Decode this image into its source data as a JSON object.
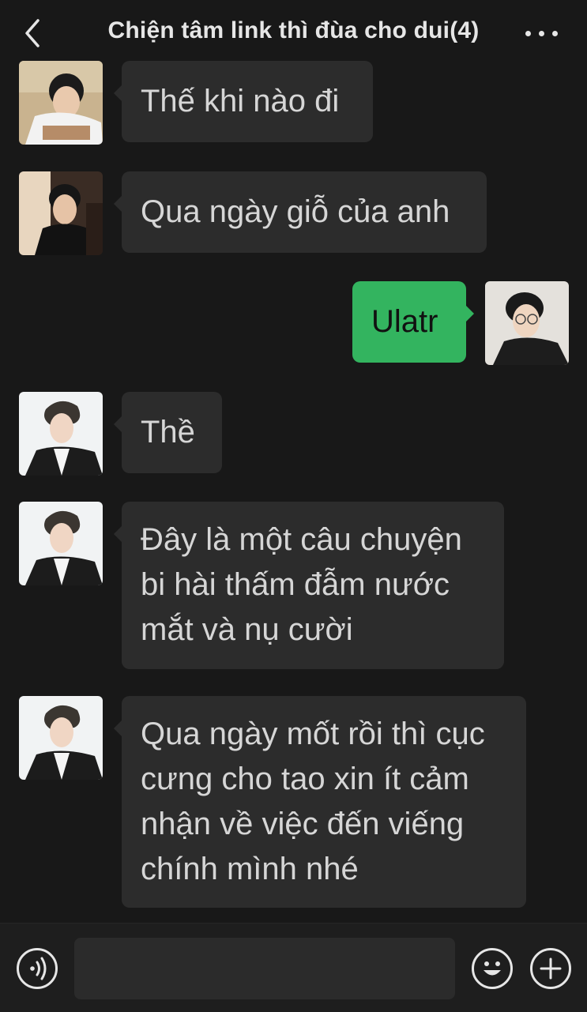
{
  "header": {
    "title": "Chiện tâm link thì đùa cho dui(4)",
    "back_icon": "chevron-left-icon",
    "more_icon": "more-dots-icon"
  },
  "messages": [
    {
      "side": "left",
      "text": "Thế khi nào đi",
      "avatar": "avatar-member-1"
    },
    {
      "side": "left",
      "text": "Qua ngày giỗ của anh",
      "avatar": "avatar-member-2"
    },
    {
      "side": "right",
      "text": "Ulatr",
      "avatar": "avatar-self"
    },
    {
      "side": "left",
      "text": "Thề",
      "avatar": "avatar-member-3"
    },
    {
      "side": "left",
      "text": "Đây là một câu chuyện bi hài thấm đẫm nước mắt và nụ cười",
      "avatar": "avatar-member-3"
    },
    {
      "side": "left",
      "text": "Qua ngày mốt rồi thì cục cưng cho tao xin ít cảm nhận về việc đến viếng chính mình nhé",
      "avatar": "avatar-member-3"
    }
  ],
  "bottom_bar": {
    "voice_icon": "voice-icon",
    "input_value": "",
    "emoji_icon": "emoji-icon",
    "plus_icon": "plus-icon"
  },
  "colors": {
    "background": "#181818",
    "bubble_incoming": "#2c2c2c",
    "bubble_outgoing": "#33b45f"
  }
}
